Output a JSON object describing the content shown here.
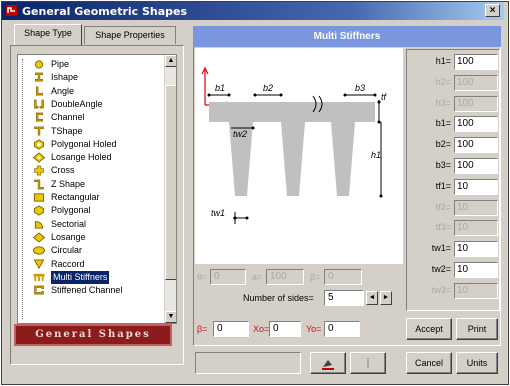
{
  "window": {
    "title": "General Geometric Shapes",
    "close_glyph": "×"
  },
  "tabs": [
    {
      "label": "Shape Type",
      "active": true
    },
    {
      "label": "Shape Properties",
      "active": false
    }
  ],
  "shape_list": {
    "items": [
      {
        "label": "Pipe",
        "icon": "pipe-icon"
      },
      {
        "label": "Ishape",
        "icon": "ishape-icon"
      },
      {
        "label": "Angle",
        "icon": "angle-icon"
      },
      {
        "label": "DoubleAngle",
        "icon": "double-angle-icon"
      },
      {
        "label": "Channel",
        "icon": "channel-icon"
      },
      {
        "label": "TShape",
        "icon": "tshape-icon"
      },
      {
        "label": "Polygonal Holed",
        "icon": "polygonal-holed-icon"
      },
      {
        "label": "Losange Holed",
        "icon": "losange-holed-icon"
      },
      {
        "label": "Cross",
        "icon": "cross-icon"
      },
      {
        "label": "Z Shape",
        "icon": "zshape-icon"
      },
      {
        "label": "Rectangular",
        "icon": "rectangular-icon"
      },
      {
        "label": "Polygonal",
        "icon": "polygonal-icon"
      },
      {
        "label": "Sectorial",
        "icon": "sectorial-icon"
      },
      {
        "label": "Losange",
        "icon": "losange-icon"
      },
      {
        "label": "Circular",
        "icon": "circular-icon"
      },
      {
        "label": "Raccord",
        "icon": "raccord-icon"
      },
      {
        "label": "Multi Stiffners",
        "icon": "multi-stiffners-icon",
        "selected": true
      },
      {
        "label": "Stiffened Channel",
        "icon": "stiffened-channel-icon"
      }
    ]
  },
  "banner": "General Shapes",
  "panel": {
    "title": "Multi Stiffners"
  },
  "drawing": {
    "labels": {
      "b1": "b1",
      "b2": "b2",
      "b3": "b3",
      "tf": "tf",
      "tw1": "tw1",
      "tw2": "tw2",
      "h1": "h1"
    }
  },
  "params": [
    {
      "label": "h1=",
      "value": "100",
      "enabled": true
    },
    {
      "label": "h2=",
      "value": "100",
      "enabled": false
    },
    {
      "label": "h3=",
      "value": "100",
      "enabled": false
    },
    {
      "label": "b1=",
      "value": "100",
      "enabled": true
    },
    {
      "label": "b2=",
      "value": "100",
      "enabled": true
    },
    {
      "label": "b3=",
      "value": "100",
      "enabled": true
    },
    {
      "label": "tf1=",
      "value": "10",
      "enabled": true
    },
    {
      "label": "tf2=",
      "value": "10",
      "enabled": false
    },
    {
      "label": "tf3=",
      "value": "10",
      "enabled": false
    },
    {
      "label": "tw1=",
      "value": "10",
      "enabled": true
    },
    {
      "label": "tw2=",
      "value": "10",
      "enabled": true
    },
    {
      "label": "tw3=",
      "value": "10",
      "enabled": false
    }
  ],
  "aux_fields": [
    {
      "label": "θ=",
      "value": "0"
    },
    {
      "label": "a=",
      "value": "100"
    },
    {
      "label": "β=",
      "value": "0"
    }
  ],
  "sides": {
    "label": "Number of sides=",
    "value": "5"
  },
  "position": [
    {
      "label": "β=",
      "value": "0"
    },
    {
      "label": "Xo=",
      "value": "0"
    },
    {
      "label": "Yo=",
      "value": "0"
    }
  ],
  "buttons": {
    "accept": "Accept",
    "print": "Print",
    "cancel": "Cancel",
    "units": "Units"
  }
}
